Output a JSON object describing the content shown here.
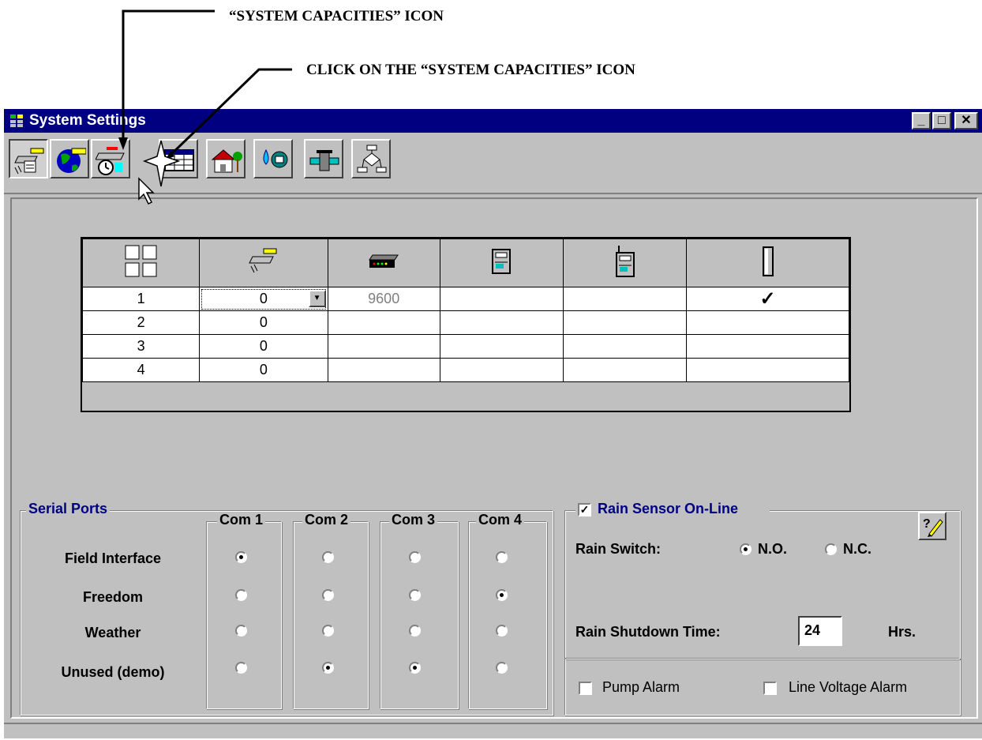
{
  "annotations": {
    "top": "“SYSTEM CAPACITIES” ICON",
    "second": "CLICK ON THE “SYSTEM CAPACITIES” ICON"
  },
  "window": {
    "title": "System Settings",
    "controls": [
      "_",
      "□",
      "✕"
    ]
  },
  "toolbar": {
    "buttons": [
      "field-interface-icon",
      "globe-ruler-icon",
      "system-capacities-icon",
      "calendar-grid-icon",
      "house-tree-icon",
      "water-meter-icon",
      "pipe-icon",
      "flowchart-icon"
    ]
  },
  "grid": {
    "columns": [
      "port-number-icon",
      "field-interface-icon",
      "modem-icon",
      "radio-unit-icon",
      "antenna-radio-icon",
      "bar-icon"
    ],
    "rows": [
      {
        "num": "1",
        "interface": "0",
        "baud": "9600",
        "c4": "",
        "c5": "",
        "check": "✓"
      },
      {
        "num": "2",
        "interface": "0",
        "baud": "",
        "c4": "",
        "c5": "",
        "check": ""
      },
      {
        "num": "3",
        "interface": "0",
        "baud": "",
        "c4": "",
        "c5": "",
        "check": ""
      },
      {
        "num": "4",
        "interface": "0",
        "baud": "",
        "c4": "",
        "c5": "",
        "check": ""
      }
    ]
  },
  "serial_ports": {
    "title": "Serial Ports",
    "coms": [
      "Com 1",
      "Com 2",
      "Com 3",
      "Com 4"
    ],
    "rows": [
      {
        "label": "Field Interface",
        "selected_com": 1
      },
      {
        "label": "Freedom",
        "selected_com": 4
      },
      {
        "label": "Weather",
        "selected_com": 0
      },
      {
        "label": "Unused (demo)",
        "selected_com": [
          2,
          3
        ]
      }
    ]
  },
  "rain": {
    "sensor_label": "Rain Sensor On-Line",
    "sensor_checked": true,
    "switch_label": "Rain Switch:",
    "no_label": "N.O.",
    "nc_label": "N.C.",
    "no_selected": true,
    "shutdown_label": "Rain Shutdown Time:",
    "shutdown_value": "24",
    "shutdown_unit": "Hrs.",
    "pump_alarm": "Pump Alarm",
    "line_voltage_alarm": "Line Voltage Alarm"
  },
  "colors": {
    "titlebar": "#000080",
    "face": "#c0c0c0",
    "accent_text": "#000080"
  }
}
